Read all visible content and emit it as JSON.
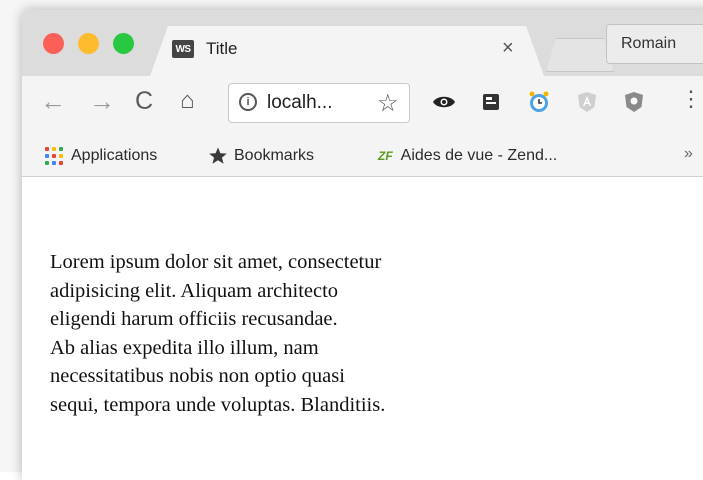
{
  "tab": {
    "title": "Title",
    "favicon_text": "WS",
    "close_label": "×"
  },
  "profile": {
    "name": "Romain"
  },
  "toolbar": {
    "back_glyph": "←",
    "forward_glyph": "→",
    "reload_glyph": "C",
    "home_glyph": "⌂",
    "info_glyph": "i",
    "url": "localh...",
    "star_glyph": "☆",
    "menu_glyph": "⋮",
    "extensions": [
      "eye-icon",
      "square-icon",
      "clock-icon",
      "angular-icon",
      "shield-icon"
    ]
  },
  "bookmarks": {
    "apps_label": "Applications",
    "bookmarks_label": "Bookmarks",
    "zend_icon": "ZF",
    "zend_label": "Aides de vue - Zend...",
    "more_glyph": "»"
  },
  "content": {
    "lines": [
      "Lorem ipsum dolor sit amet, consectetur",
      "adipisicing elit. Aliquam architecto",
      "eligendi harum officiis recusandae.",
      "Ab alias expedita illo illum, nam",
      "necessitatibus nobis non optio quasi",
      "sequi, tempora unde voluptas. Blanditiis."
    ]
  },
  "colors": {
    "close": "#fc5f57",
    "minimize": "#fdbb2d",
    "maximize": "#28c840",
    "apps_grid": [
      "#ea4335",
      "#fbbc05",
      "#34a853",
      "#4285f4",
      "#ea4335",
      "#fbbc05",
      "#34a853",
      "#4285f4",
      "#ea4335"
    ]
  }
}
